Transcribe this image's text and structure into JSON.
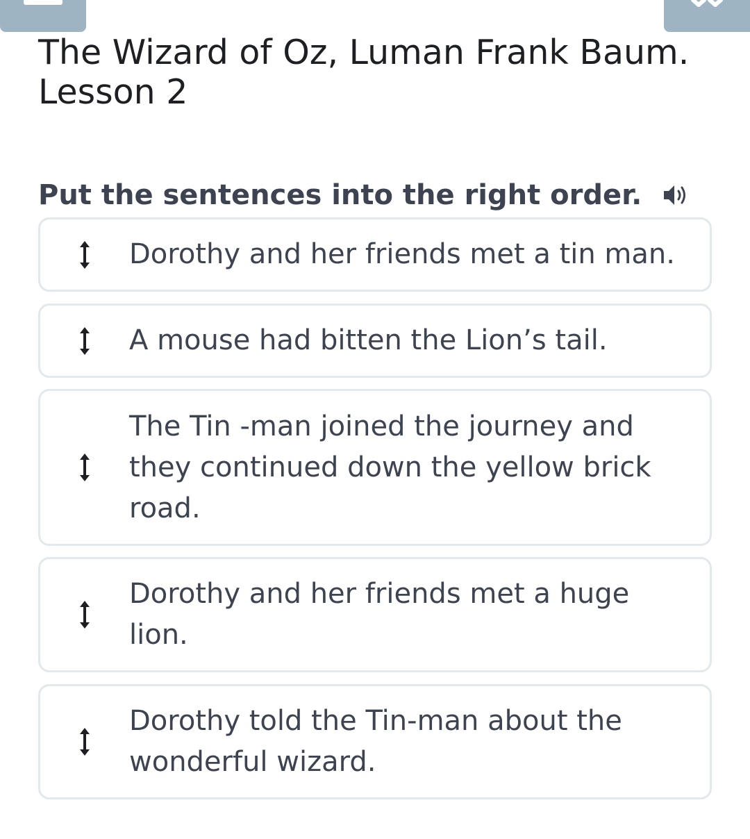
{
  "header": {
    "title": "The Wizard of Oz, Luman Frank Baum. Lesson 2"
  },
  "task": {
    "instruction": "Put the sentences into the right order.",
    "sound_icon": "speaker-icon"
  },
  "items": [
    {
      "text": "Dorothy and her friends met a tin man.",
      "icon": "vertical-arrows-icon"
    },
    {
      "text": "A mouse had bitten the Lion’s tail.",
      "icon": "vertical-arrows-icon"
    },
    {
      "text": "The Tin -man joined the journey and they continued down the yellow brick road.",
      "icon": "vertical-arrows-icon"
    },
    {
      "text": "Dorothy and her friends met a huge lion.",
      "icon": "vertical-arrows-icon"
    },
    {
      "text": "Dorothy told the Tin-man about the wonderful wizard.",
      "icon": "vertical-arrows-icon"
    }
  ],
  "colors": {
    "top_button": "#9fb4c2",
    "text": "#3d4350",
    "title": "#1d1f23",
    "card_border": "#e3e8ec"
  }
}
